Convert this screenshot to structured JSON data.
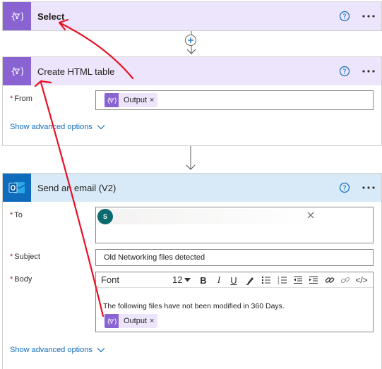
{
  "cards": {
    "select": {
      "title": "Select"
    },
    "html_table": {
      "title": "Create HTML table",
      "from_label": "From",
      "from_token": "Output",
      "advanced": "Show advanced options"
    },
    "email": {
      "title": "Send an email (V2)",
      "to_label": "To",
      "recipient_avatar": "S",
      "subject_label": "Subject",
      "subject_value": "Old Networking files detected",
      "body_label": "Body",
      "font_select": "Font",
      "font_size": "12",
      "body_text": "The following files have not been modified in 360 Days.",
      "body_token": "Output",
      "advanced": "Show advanced options"
    }
  },
  "labels": {
    "required_mark": "*",
    "token_remove": "×",
    "help": "?",
    "toolbar_bold": "B",
    "toolbar_italic": "I",
    "toolbar_underline": "U",
    "toolbar_code": "</>"
  },
  "colors": {
    "action_purple": "#8a63d2",
    "action_purple_light": "#ede5fb",
    "outlook_blue": "#0f6cbd",
    "outlook_blue_light": "#d8eaf7",
    "annotation_red": "#e81123"
  },
  "icons": [
    "filter-braces-icon",
    "help-icon",
    "more-icon",
    "plus-icon",
    "arrow-down-icon",
    "outlook-icon",
    "chevron-down-icon",
    "close-icon"
  ]
}
